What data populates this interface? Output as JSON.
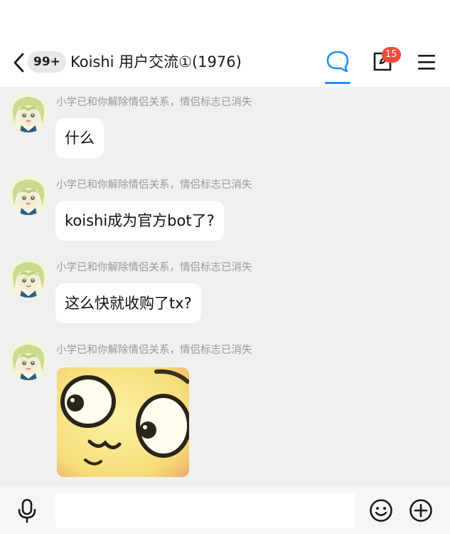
{
  "header": {
    "unread_count": "99+",
    "group_title": "Koishi 用户交流①(1976)",
    "notification_count": "15",
    "active_tab_color": "#1e90ff"
  },
  "messages": [
    {
      "sender": "小学已和你解除情侣关系，情侣标志已消失",
      "text": "什么"
    },
    {
      "sender": "小学已和你解除情侣关系，情侣标志已消失",
      "text": "koishi成为官方bot了?"
    },
    {
      "sender": "小学已和你解除情侣关系，情侣标志已消失",
      "text": "这么快就收购了tx?"
    },
    {
      "sender": "小学已和你解除情侣关系，情侣标志已消失",
      "image": "surprised-face-sticker"
    }
  ],
  "input": {
    "placeholder": "",
    "value": ""
  },
  "icons": {
    "back": "chevron-left-icon",
    "chat_tab": "chat-bubble-icon",
    "post": "edit-square-icon",
    "menu": "hamburger-menu-icon",
    "mic": "microphone-icon",
    "emoji": "smiley-icon",
    "plus": "plus-circle-icon"
  }
}
